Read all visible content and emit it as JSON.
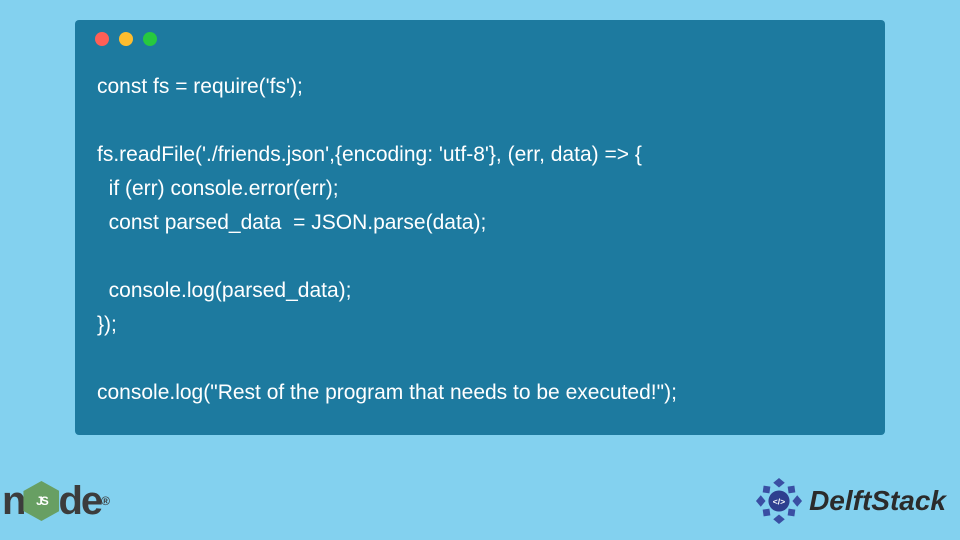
{
  "window": {
    "traffic_light_colors": [
      "#ff5f56",
      "#ffbd2e",
      "#27c93f"
    ]
  },
  "code": {
    "lines": [
      "const fs = require('fs');",
      "",
      "fs.readFile('./friends.json',{encoding: 'utf-8'}, (err, data) => {",
      "  if (err) console.error(err);",
      "  const parsed_data  = JSON.parse(data);",
      "",
      "  console.log(parsed_data);",
      "});",
      "",
      "console.log(\"Rest of the program that needs to be executed!\");"
    ]
  },
  "footer": {
    "node_label_left": "n",
    "node_label_right": "de",
    "node_hex_text": "JS",
    "node_registered": "®",
    "delft_label": "DelftStack",
    "delft_code_glyph": "</>"
  }
}
